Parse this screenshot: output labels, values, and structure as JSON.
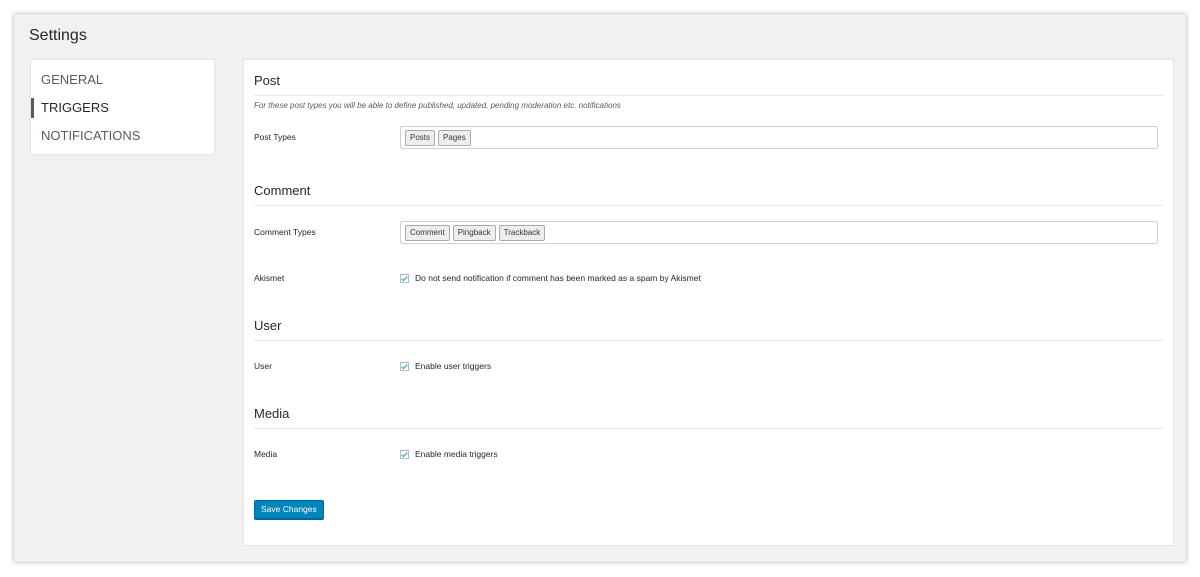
{
  "page": {
    "title": "Settings"
  },
  "tabs": [
    {
      "label": "GENERAL",
      "active": false
    },
    {
      "label": "TRIGGERS",
      "active": true
    },
    {
      "label": "NOTIFICATIONS",
      "active": false
    }
  ],
  "sections": {
    "post": {
      "title": "Post",
      "description": "For these post types you will be able to define published, updated, pending moderation etc. notifications",
      "post_types": {
        "label": "Post Types",
        "chips": [
          "Posts",
          "Pages"
        ]
      }
    },
    "comment": {
      "title": "Comment",
      "comment_types": {
        "label": "Comment Types",
        "chips": [
          "Comment",
          "Pingback",
          "Trackback"
        ]
      },
      "akismet": {
        "label": "Akismet",
        "checkbox_label": "Do not send notification if comment has been marked as a spam by Akismet",
        "checked": true
      }
    },
    "user": {
      "title": "User",
      "field": {
        "label": "User",
        "checkbox_label": "Enable user triggers",
        "checked": true
      }
    },
    "media": {
      "title": "Media",
      "field": {
        "label": "Media",
        "checkbox_label": "Enable media triggers",
        "checked": true
      }
    }
  },
  "actions": {
    "save_label": "Save Changes"
  },
  "colors": {
    "primary_button": "#0085ba",
    "checkmark": "#1e8cbe",
    "background": "#f1f1f1"
  }
}
